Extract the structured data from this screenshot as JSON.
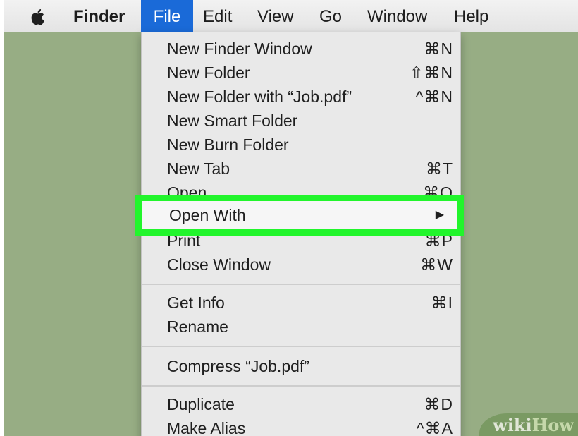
{
  "menubar": {
    "apple_icon": "apple-logo",
    "items": [
      "Finder",
      "File",
      "Edit",
      "View",
      "Go",
      "Window",
      "Help"
    ]
  },
  "file_menu": {
    "items": [
      {
        "label": "New Finder Window",
        "shortcut": "⌘N"
      },
      {
        "label": "New Folder",
        "shortcut": "⇧⌘N"
      },
      {
        "label": "New Folder with “Job.pdf”",
        "shortcut": "^⌘N"
      },
      {
        "label": "New Smart Folder",
        "shortcut": ""
      },
      {
        "label": "New Burn Folder",
        "shortcut": ""
      },
      {
        "label": "New Tab",
        "shortcut": "⌘T"
      },
      {
        "label": "Open",
        "shortcut": "⌘O"
      },
      {
        "label": "Open With",
        "shortcut": "▶"
      },
      {
        "label": "Print",
        "shortcut": "⌘P"
      },
      {
        "label": "Close Window",
        "shortcut": "⌘W"
      },
      {
        "label": "Get Info",
        "shortcut": "⌘I"
      },
      {
        "label": "Rename",
        "shortcut": ""
      },
      {
        "label": "Compress “Job.pdf”",
        "shortcut": ""
      },
      {
        "label": "Duplicate",
        "shortcut": "⌘D"
      },
      {
        "label": "Make Alias",
        "shortcut": "^⌘A"
      }
    ]
  },
  "highlight_color": "#22f52c",
  "watermark": {
    "part1": "wiki",
    "part2": "How"
  }
}
